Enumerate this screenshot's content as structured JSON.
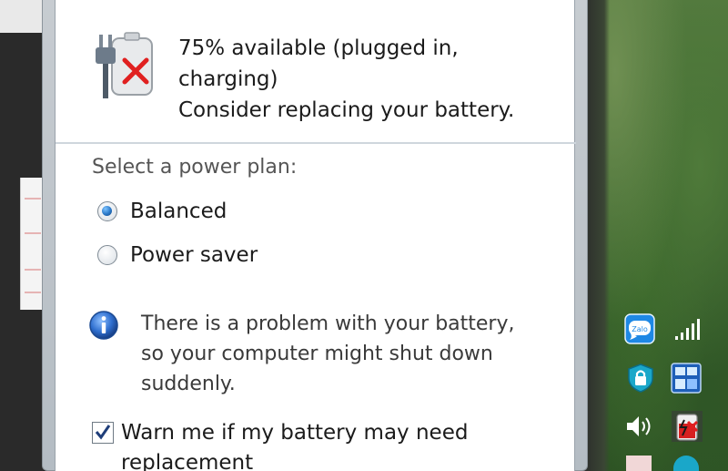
{
  "flyout": {
    "status_line1": "75% available (plugged in,",
    "status_line2": "charging)",
    "status_line3": "Consider replacing your battery.",
    "power_plan_label": "Select a power plan:",
    "plans": [
      {
        "label": "Balanced",
        "selected": true
      },
      {
        "label": "Power saver",
        "selected": false
      }
    ],
    "info_line1": "There is a problem with your battery,",
    "info_line2": "so your computer might shut down",
    "info_line3": "suddenly.",
    "warn_checkbox_label": "Warn me if my battery may need",
    "warn_checkbox_label_cont": "replacement",
    "warn_checked": true
  },
  "tray": {
    "icons": [
      "zalo-icon",
      "signal-bars-icon",
      "shield-lock-icon",
      "network-manager-icon",
      "speaker-icon",
      "battery-warning-icon"
    ],
    "zalo_text": "Zalo"
  },
  "colors": {
    "radio_selected": "#2a78c8",
    "warning_red": "#e02020",
    "info_blue": "#2f6fcf"
  }
}
